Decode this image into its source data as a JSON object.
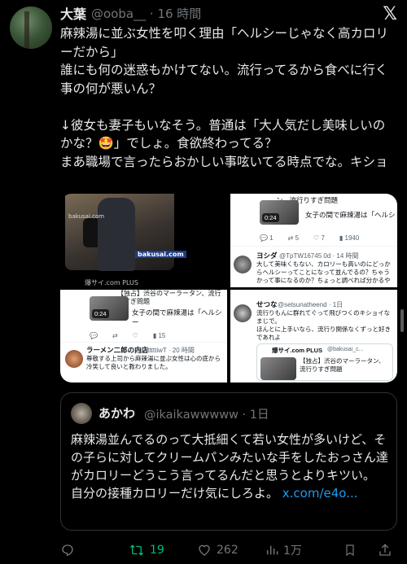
{
  "tweet": {
    "name": "大葉",
    "handle": "@ooba__",
    "separator": "·",
    "time": "16 時間",
    "logo": "𝕏",
    "text": "麻辣湯に並ぶ女性を叩く理由「ヘルシーじゃなく高カロリーだから」\n誰にも何の迷惑もかけてない。流行ってるから食べに行く事の何が悪いん？\n\n↓彼女も妻子もいなそう。普通は「大人気だし美味しいのかな？🤩」でしょ。食欲終わってる？\nまあ職場で言ったらおかしい事呟いてる時点でな。キショ"
  },
  "media": {
    "tile1": {
      "brand": "bakusai.com",
      "brand_small": "bakusai.com",
      "footer": "爆サイ.com PLUS"
    },
    "tile2": {
      "headline": "ン、流行りすぎ問題",
      "duration": "0:24",
      "caption": "女子の間で麻辣湯は「ヘルシ",
      "stats": [
        "1",
        "5",
        "7",
        "1940"
      ],
      "reply_name": "ヨシダ",
      "reply_handle": "@TpTW16745 0d · 14 時間",
      "reply_text": "大して美味くもない、カロリーも高いのにどっからヘルシーってことになって並んでるの？ちゃうかって事になるのか？ちょっと調べれば分かるや"
    },
    "tile3": {
      "headline": "【独占】渋谷のマーラータン、流行りすぎ問題",
      "duration": "0:24",
      "caption": "女子の間で麻辣湯は「ヘルシー",
      "stats": [
        "",
        "",
        "",
        "15"
      ],
      "reply_name": "ラーメン二郎の内店",
      "reply_handle": "@retttttiwT · 20 時間",
      "reply_text": "尊敬する上司から麻辣湯に並ぶ女性は心の底から冷笑して良いと教わりました。"
    },
    "tile4": {
      "reply_name": "せつな",
      "reply_handle": "@setsunatheend · 1日",
      "reply_text": "流行りもんに群れてぐって飛びつくのキショイなまじで。\nほんとに上手いなら、流行り関係なくずっと好きであれよ",
      "card_name": "爆サイ.com PLUS",
      "card_handle": "@bakusai_c...",
      "card_title": "【独占】渋谷のマーラータン、流行りすぎ問題"
    }
  },
  "quote": {
    "name": "あかわ",
    "handle": "@ikaikawwwww · 1日",
    "text": "麻辣湯並んでるのって大抵細くて若い女性が多いけど、その子らに対してクリームパンみたいな手をしたおっさん達がカロリーどうこう言ってるんだと思うとよりキツい。\n自分の接種カロリーだけ気にしろよ。 ",
    "link": "x.com/e4o..."
  },
  "actions": {
    "reply_count": "",
    "retweet_count": "19",
    "like_count": "262",
    "view_count": "1万"
  },
  "colors": {
    "accent": "#1d9bf0",
    "retweet": "#00ba7c",
    "muted": "#71767b"
  }
}
